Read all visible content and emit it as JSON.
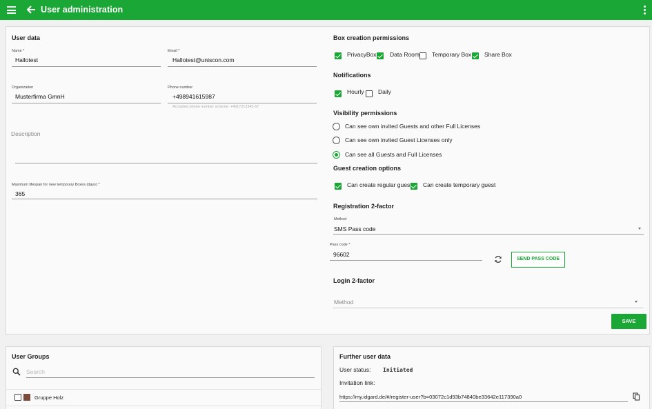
{
  "header": {
    "title": "User administration"
  },
  "user_data": {
    "heading": "User data",
    "name": {
      "label": "Name",
      "value": "Hallotest"
    },
    "email": {
      "label": "Email",
      "value": "Hallotest@uniscon.com"
    },
    "organization": {
      "label": "Organization",
      "value": "Musterfirma GmnH"
    },
    "phone": {
      "label": "Phone number",
      "value": "+498941615987",
      "hint": "Accepted phone number scheme: +4917212345 67"
    },
    "description": {
      "placeholder": "Description"
    },
    "lifespan": {
      "label": "Maximum lifespan for new temporary Boxes (days)",
      "value": "365"
    }
  },
  "box_creation": {
    "heading": "Box creation permissions",
    "options": [
      {
        "label": "PrivacyBox",
        "checked": true
      },
      {
        "label": "Data Room",
        "checked": true
      },
      {
        "label": "Temporary Box",
        "checked": false
      },
      {
        "label": "Share Box",
        "checked": true
      }
    ]
  },
  "notifications": {
    "heading": "Notifications",
    "options": [
      {
        "label": "Hourly",
        "checked": true
      },
      {
        "label": "Daily",
        "checked": false
      }
    ]
  },
  "visibility": {
    "heading": "Visibility permissions",
    "options": [
      {
        "label": "Can see own invited Guests and other Full Licenses",
        "selected": false
      },
      {
        "label": "Can see own invited Guest Licenses only",
        "selected": false
      },
      {
        "label": "Can see all Guests and Full Licenses",
        "selected": true
      }
    ]
  },
  "guest_creation": {
    "heading": "Guest creation options",
    "options": [
      {
        "label": "Can create regular guest",
        "checked": true
      },
      {
        "label": "Can create temporary guest",
        "checked": true
      }
    ]
  },
  "registration_2fa": {
    "heading": "Registration 2-factor",
    "method_label": "Method",
    "method_value": "SMS Pass code",
    "passcode_label": "Pass code",
    "passcode_value": "96602",
    "send_button": "SEND PASS CODE"
  },
  "login_2fa": {
    "heading": "Login 2-factor",
    "method_placeholder": "Method"
  },
  "save_button": "SAVE",
  "user_groups": {
    "heading": "User Groups",
    "search_placeholder": "Search",
    "items": [
      {
        "label": "Gruppe Holz",
        "color": "#7b4a3a"
      }
    ]
  },
  "further": {
    "heading": "Further user data",
    "status_label": "User status:",
    "status_value": "Initiated",
    "invitation_label": "Invitation link:",
    "invitation_value": "https://my.idgard.de/#/register-user?b=03072c1d93b74840be33642e117390a0"
  },
  "colors": {
    "accent": "#1aa736"
  }
}
